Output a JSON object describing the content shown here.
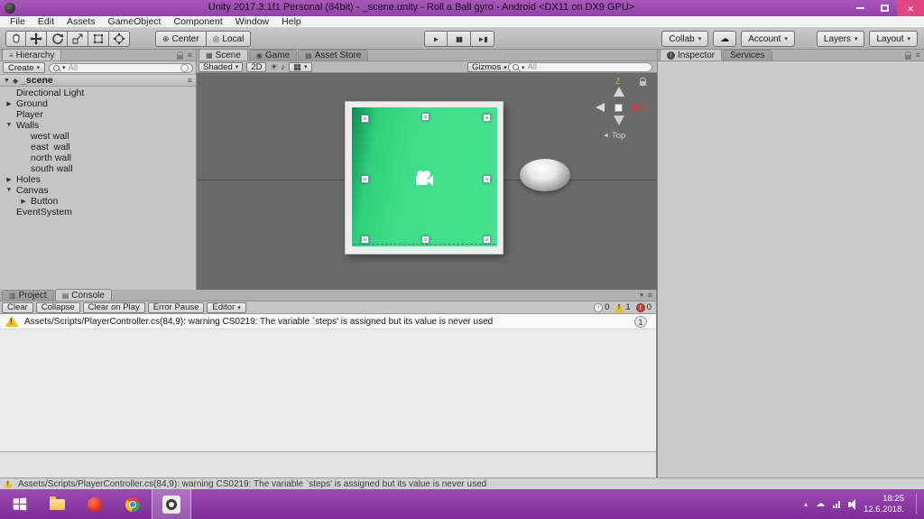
{
  "window": {
    "title": "Unity 2017.3.1f1 Personal (64bit) - _scene.unity - Roll a Ball gyro - Android <DX11 on DX9 GPU>"
  },
  "menu": {
    "items": [
      "File",
      "Edit",
      "Assets",
      "GameObject",
      "Component",
      "Window",
      "Help"
    ]
  },
  "toolbar": {
    "center": "Center",
    "local": "Local",
    "collab": "Collab",
    "account": "Account",
    "layers": "Layers",
    "layout": "Layout"
  },
  "hierarchy": {
    "tab": "Hierarchy",
    "create": "Create",
    "search_filter": "All",
    "scene_name": "_scene",
    "items": [
      {
        "label": "Directional Light",
        "arrow": "",
        "level": 1
      },
      {
        "label": "Ground",
        "arrow": "▶",
        "level": 1
      },
      {
        "label": "Player",
        "arrow": "",
        "level": 1
      },
      {
        "label": "Walls",
        "arrow": "▼",
        "level": 1
      },
      {
        "label": "west wall",
        "arrow": "",
        "level": 2
      },
      {
        "label": "east  wall",
        "arrow": "",
        "level": 2
      },
      {
        "label": "north wall",
        "arrow": "",
        "level": 2
      },
      {
        "label": "south wall",
        "arrow": "",
        "level": 2
      },
      {
        "label": "Holes",
        "arrow": "▶",
        "level": 1
      },
      {
        "label": "Canvas",
        "arrow": "▼",
        "level": 1
      },
      {
        "label": "Button",
        "arrow": "▶",
        "level": 2
      },
      {
        "label": "EventSystem",
        "arrow": "",
        "level": 1
      }
    ]
  },
  "scene": {
    "tab_scene": "Scene",
    "tab_game": "Game",
    "tab_store": "Asset Store",
    "shaded": "Shaded",
    "mode_2d": "2D",
    "gizmos": "Gizmos",
    "search_filter": "All",
    "view": "Top",
    "axis_z": "Z",
    "axis_x": "X"
  },
  "console": {
    "tab_project": "Project",
    "tab_console": "Console",
    "buttons": {
      "clear": "Clear",
      "collapse": "Collapse",
      "clear_on_play": "Clear on Play",
      "error_pause": "Error Pause",
      "editor": "Editor"
    },
    "counts": {
      "info": "0",
      "warnings": "1",
      "errors": "0"
    },
    "entry": {
      "message": "Assets/Scripts/PlayerController.cs(84,9): warning CS0219: The variable `steps' is assigned but its value is never used",
      "count": "1"
    }
  },
  "inspector": {
    "tab_inspector": "Inspector",
    "tab_services": "Services"
  },
  "taskbar": {
    "time": "18:25",
    "date": "12.6.2018."
  },
  "icons": {
    "caret": "▾",
    "tri_down": "▼",
    "play": "►",
    "pause": "▮▮",
    "step": "►▮",
    "close": "×",
    "sun": "☀",
    "audio": "♪",
    "cloud": "☁",
    "menu": "≡",
    "center": "⊕",
    "local": "◎",
    "effects": "▦",
    "chevron_up": "▴",
    "info_letter": "i",
    "back": "◄",
    "scene_icon": "◆",
    "tab_scene": "▦",
    "tab_game": "◉",
    "tab_store": "▤",
    "tab_project": "▥",
    "tab_console": "▤",
    "tab_hierarchy": "≡"
  },
  "colors": {
    "accent_green": "#3ddc84",
    "titlebar": "#9a4bac",
    "warning": "#f2c200"
  }
}
